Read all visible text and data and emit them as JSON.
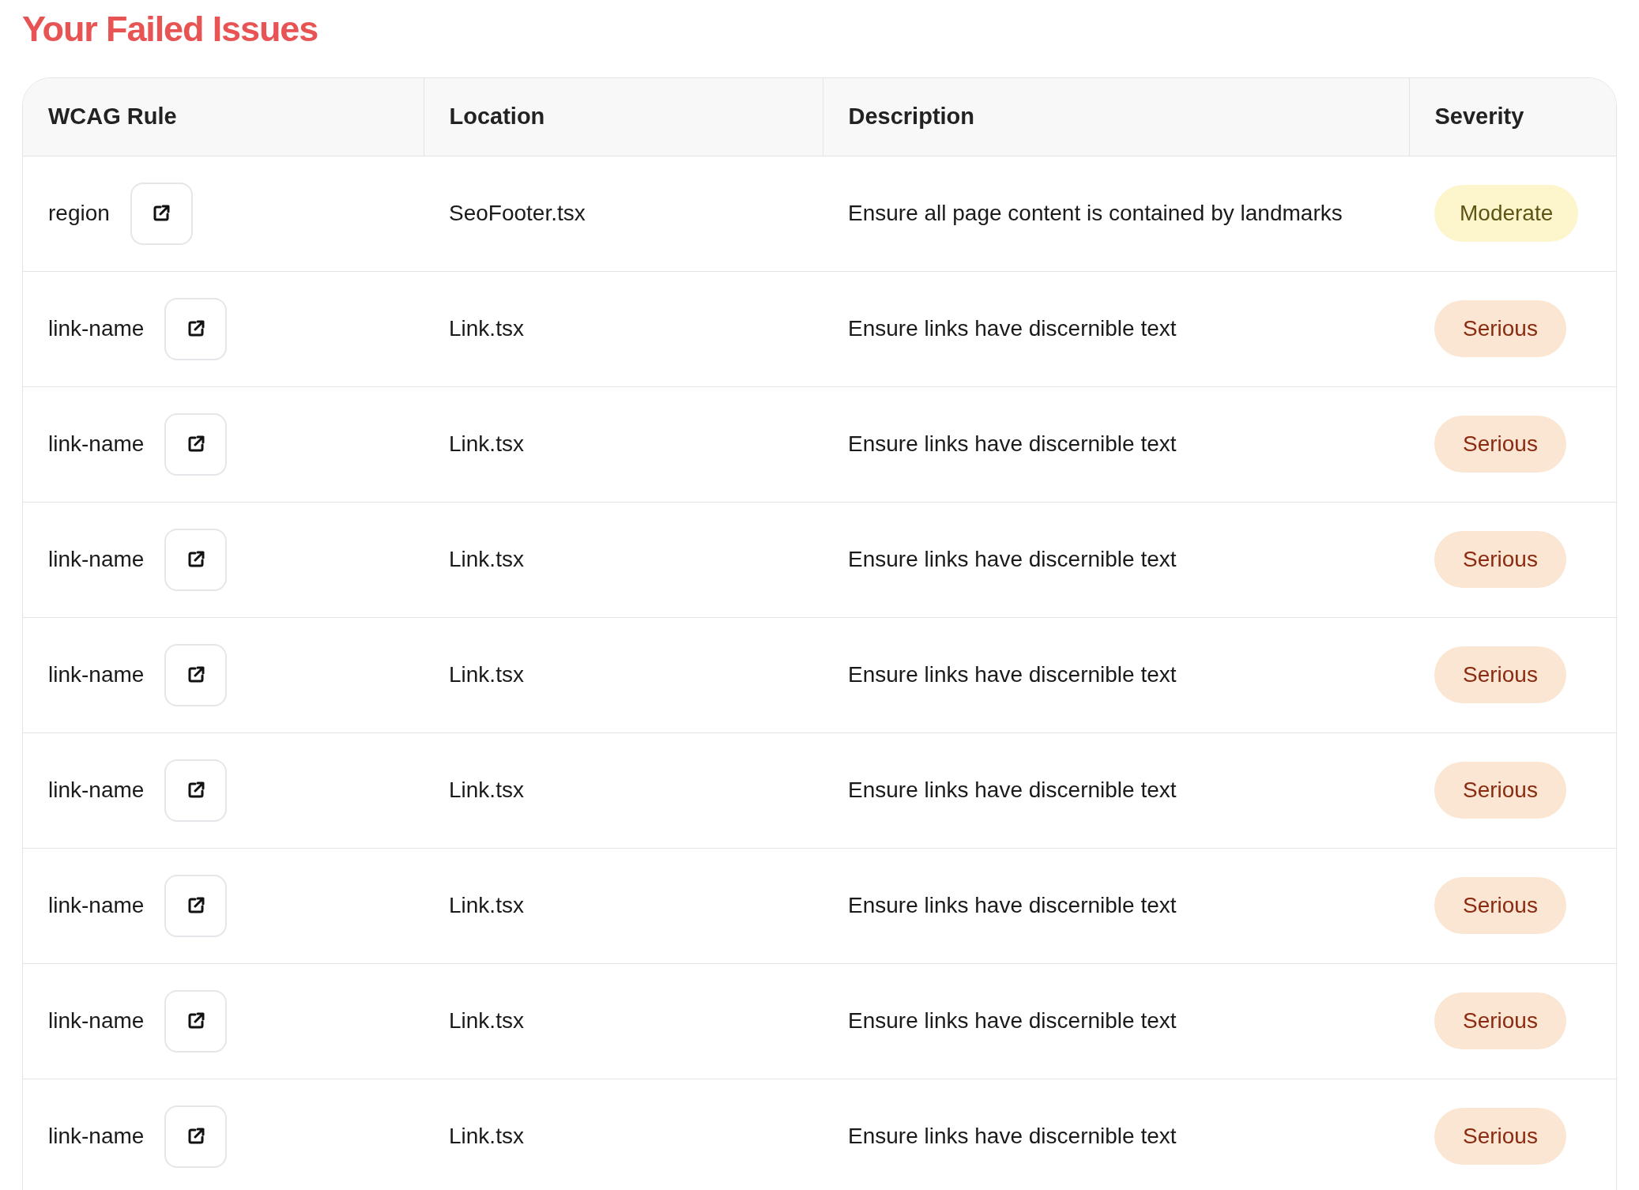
{
  "title": "Your Failed Issues",
  "table": {
    "columns": [
      "WCAG Rule",
      "Location",
      "Description",
      "Severity"
    ],
    "rows": [
      {
        "rule": "region",
        "location": "SeoFooter.tsx",
        "description": "Ensure all page content is contained by landmarks",
        "severity": {
          "label": "Moderate",
          "kind": "moderate"
        }
      },
      {
        "rule": "link-name",
        "location": "Link.tsx",
        "description": "Ensure links have discernible text",
        "severity": {
          "label": "Serious",
          "kind": "serious"
        }
      },
      {
        "rule": "link-name",
        "location": "Link.tsx",
        "description": "Ensure links have discernible text",
        "severity": {
          "label": "Serious",
          "kind": "serious"
        }
      },
      {
        "rule": "link-name",
        "location": "Link.tsx",
        "description": "Ensure links have discernible text",
        "severity": {
          "label": "Serious",
          "kind": "serious"
        }
      },
      {
        "rule": "link-name",
        "location": "Link.tsx",
        "description": "Ensure links have discernible text",
        "severity": {
          "label": "Serious",
          "kind": "serious"
        }
      },
      {
        "rule": "link-name",
        "location": "Link.tsx",
        "description": "Ensure links have discernible text",
        "severity": {
          "label": "Serious",
          "kind": "serious"
        }
      },
      {
        "rule": "link-name",
        "location": "Link.tsx",
        "description": "Ensure links have discernible text",
        "severity": {
          "label": "Serious",
          "kind": "serious"
        }
      },
      {
        "rule": "link-name",
        "location": "Link.tsx",
        "description": "Ensure links have discernible text",
        "severity": {
          "label": "Serious",
          "kind": "serious"
        }
      },
      {
        "rule": "link-name",
        "location": "Link.tsx",
        "description": "Ensure links have discernible text",
        "severity": {
          "label": "Serious",
          "kind": "serious"
        }
      }
    ]
  }
}
